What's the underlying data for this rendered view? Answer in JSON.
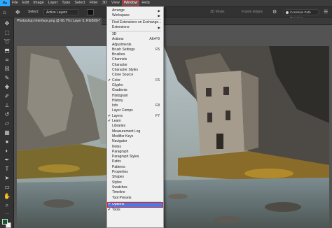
{
  "app": {
    "logo": "Ps"
  },
  "menubar": {
    "items": [
      "File",
      "Edit",
      "Image",
      "Layer",
      "Type",
      "Select",
      "Filter",
      "3D",
      "View",
      "Window",
      "Help"
    ],
    "active": "Window"
  },
  "options": {
    "home_icon": "home-icon",
    "move_icon": "move-tool-icon",
    "auto_select_label": "Select:",
    "auto_select_value": "Active Layers",
    "transform_label": "▾",
    "mode_3d": "3D Mode:",
    "frame": "Frame Edges",
    "share_label": "Constrain Path Dragging",
    "gear_icon": "gear-icon"
  },
  "document": {
    "tab_title": "Photoshop Interface.png @ 66.7% (Layer 0, RGB/8) *",
    "close": "×"
  },
  "tools": [
    "move-tool-icon",
    "artboard-icon",
    "lasso-icon",
    "object-select-icon",
    "crop-icon",
    "frame-icon",
    "eyedropper-icon",
    "healing-brush-icon",
    "brush-icon",
    "clone-stamp-icon",
    "history-brush-icon",
    "eraser-icon",
    "gradient-icon",
    "blur-icon",
    "dodge-icon",
    "pen-icon",
    "type-icon",
    "path-select-icon",
    "rectangle-icon",
    "hand-icon",
    "zoom-icon",
    "more-tools-icon"
  ],
  "colors": {
    "foreground": "#0c5a2b",
    "background": "#f2f2f2",
    "accent": "#e0262f",
    "highlight": "#3e7ff0"
  },
  "window_menu": {
    "items": [
      {
        "label": "Arrange",
        "arrow": "▶"
      },
      {
        "label": "Workspace",
        "arrow": "▶"
      },
      {
        "sep": true
      },
      {
        "label": "Find Extensions on Exchange..."
      },
      {
        "label": "Extensions",
        "arrow": "▶"
      },
      {
        "sep": true
      },
      {
        "label": "3D"
      },
      {
        "label": "Actions",
        "shortcut": "Alt+F9"
      },
      {
        "label": "Adjustments"
      },
      {
        "label": "Brush Settings",
        "shortcut": "F5"
      },
      {
        "label": "Brushes"
      },
      {
        "label": "Channels"
      },
      {
        "label": "Character"
      },
      {
        "label": "Character Styles"
      },
      {
        "label": "Clone Source"
      },
      {
        "label": "Color",
        "shortcut": "F6",
        "checked": true
      },
      {
        "label": "Glyphs"
      },
      {
        "label": "Gradients"
      },
      {
        "label": "Histogram"
      },
      {
        "label": "History"
      },
      {
        "label": "Info",
        "shortcut": "F8"
      },
      {
        "label": "Layer Comps"
      },
      {
        "label": "Layers",
        "shortcut": "F7",
        "checked": true
      },
      {
        "label": "Learn",
        "checked": true
      },
      {
        "label": "Libraries"
      },
      {
        "label": "Measurement Log"
      },
      {
        "label": "Modifier Keys"
      },
      {
        "label": "Navigator"
      },
      {
        "label": "Notes"
      },
      {
        "label": "Paragraph"
      },
      {
        "label": "Paragraph Styles"
      },
      {
        "label": "Paths"
      },
      {
        "label": "Patterns"
      },
      {
        "label": "Properties"
      },
      {
        "label": "Shapes"
      },
      {
        "label": "Styles"
      },
      {
        "label": "Swatches"
      },
      {
        "label": "Timeline"
      },
      {
        "label": "Tool Presets"
      },
      {
        "sep": true
      },
      {
        "label": "Options",
        "checked": true,
        "highlight": true
      },
      {
        "label": "Tools",
        "checked": true
      }
    ],
    "check_glyph": "✔"
  }
}
